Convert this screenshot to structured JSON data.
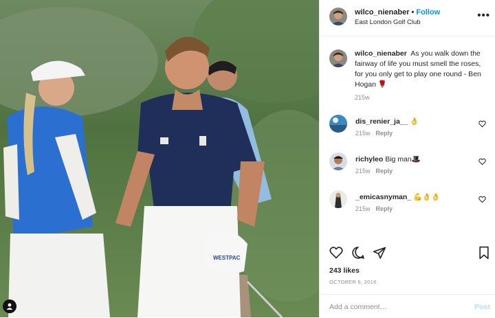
{
  "post": {
    "username": "wilco_nienaber",
    "follow_label": "Follow",
    "location": "East London Golf Club",
    "more_label": "•••",
    "caption_text": "As you walk down the fairway of life you must smell the roses, for you only get to play one round - Ben Hogan",
    "caption_emoji": "🌹",
    "caption_time": "215w",
    "likes": "243 likes",
    "date": "OCTOBER 6, 2016"
  },
  "comments": [
    {
      "username": "dis_renier_ja__",
      "text": "👌",
      "time": "215w",
      "reply": "Reply"
    },
    {
      "username": "richyleo",
      "text": "Big man🎩",
      "time": "215w",
      "reply": "Reply"
    },
    {
      "username": "_emicasnyman_",
      "text": "💪👌👌",
      "time": "215w",
      "reply": "Reply"
    }
  ],
  "add_comment": {
    "placeholder": "Add a comment…",
    "post_label": "Post"
  },
  "photo": {
    "cap_text": "WESTPAC"
  },
  "icons": {
    "like": "heart-icon",
    "comment": "comment-bubble-icon",
    "share": "paper-plane-icon",
    "save": "bookmark-icon",
    "tagged": "tagged-user-icon"
  },
  "colors": {
    "follow": "#0095f6",
    "muted": "#8e8e8e",
    "post_disabled": "#b2dffc",
    "divider": "#efefef"
  }
}
